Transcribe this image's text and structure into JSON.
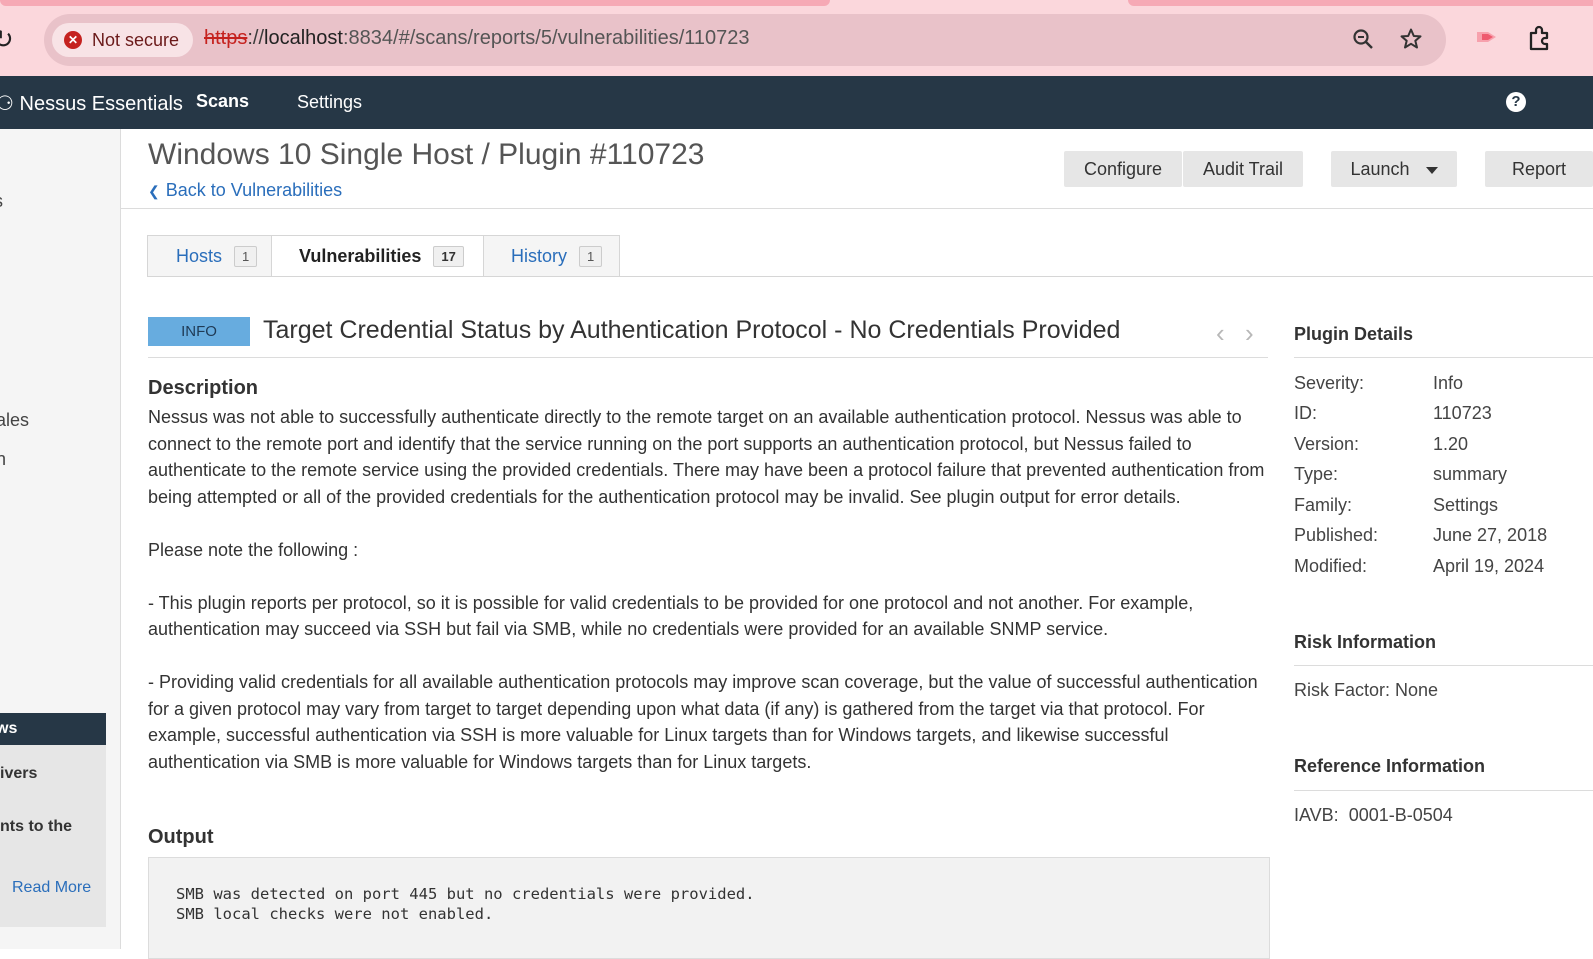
{
  "browser": {
    "security_label": "Not secure",
    "url_scheme": "https",
    "url_host": "localhost",
    "url_rest": ":8834/#/scans/reports/5/vulnerabilities/110723"
  },
  "appbar": {
    "brand": "Nessus Essentials",
    "nav_scans": "Scans",
    "nav_settings": "Settings",
    "help": "?"
  },
  "sidebar": {
    "frag_1": "s",
    "frag_2": "ales",
    "frag_3": "n",
    "box_title": "ws",
    "box_line_1": "ivers",
    "box_line_2": "nts to the",
    "read_more": "Read More"
  },
  "header": {
    "title": "Windows 10 Single Host / Plugin #110723",
    "back_link": "Back to Vulnerabilities",
    "buttons": {
      "configure": "Configure",
      "audit_trail": "Audit Trail",
      "launch": "Launch",
      "report": "Report"
    }
  },
  "tabs": [
    {
      "label": "Hosts",
      "count": "1"
    },
    {
      "label": "Vulnerabilities",
      "count": "17"
    },
    {
      "label": "History",
      "count": "1"
    }
  ],
  "vulnerability": {
    "severity": "INFO",
    "title": "Target Credential Status by Authentication Protocol - No Credentials Provided",
    "description_heading": "Description",
    "description": [
      "Nessus was not able to successfully authenticate directly to the remote target on an available authentication protocol. Nessus was able to connect to the remote port and identify that the service running on the port supports an authentication protocol, but Nessus failed to authenticate to the remote service using the provided credentials. There may have been a protocol failure that prevented authentication from being attempted or all of the provided credentials for the authentication protocol may be invalid. See plugin output for error details.",
      "Please note the following :",
      "- This plugin reports per protocol, so it is possible for valid credentials to be provided for one protocol and not another. For example, authentication may succeed via SSH but fail via SMB, while no credentials were provided for an available SNMP service.",
      "- Providing valid credentials for all available authentication protocols may improve scan coverage, but the value of successful authentication for a given protocol may vary from target to target depending upon what data (if any) is gathered from the target via that protocol. For example, successful authentication via SSH is more valuable for Linux targets than for Windows targets, and likewise successful authentication via SMB is more valuable for Windows targets than for Linux targets."
    ],
    "output_heading": "Output",
    "output": "SMB was detected on port 445 but no credentials were provided.\nSMB local checks were not enabled."
  },
  "plugin_details": {
    "heading": "Plugin Details",
    "rows": [
      {
        "key": "Severity:",
        "value": "Info"
      },
      {
        "key": "ID:",
        "value": "110723"
      },
      {
        "key": "Version:",
        "value": "1.20"
      },
      {
        "key": "Type:",
        "value": "summary"
      },
      {
        "key": "Family:",
        "value": "Settings"
      },
      {
        "key": "Published:",
        "value": "June 27, 2018"
      },
      {
        "key": "Modified:",
        "value": "April 19, 2024"
      }
    ]
  },
  "risk_information": {
    "heading": "Risk Information",
    "risk_factor": "Risk Factor: None"
  },
  "reference_information": {
    "heading": "Reference Information",
    "iavb_label": "IAVB:",
    "iavb_value": "0001-B-0504"
  }
}
